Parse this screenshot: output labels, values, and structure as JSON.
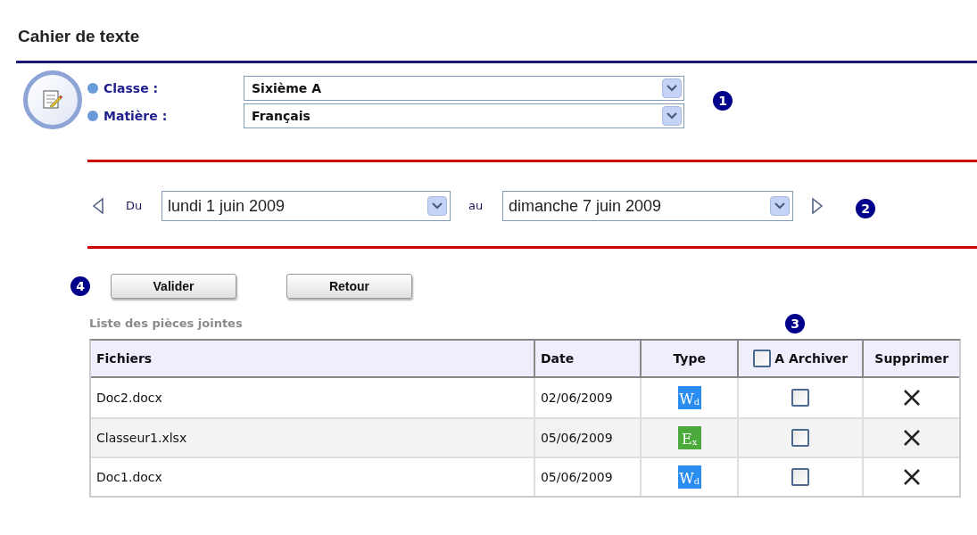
{
  "title": "Cahier de texte",
  "filters": [
    {
      "label": "Classe :",
      "value": "Sixième A"
    },
    {
      "label": "Matière :",
      "value": "Français"
    }
  ],
  "filters_marker": "1",
  "period": {
    "from_label": "Du",
    "from": "lundi 1 juin 2009",
    "to_label": "au",
    "to": "dimanche 7 juin 2009",
    "marker": "2"
  },
  "buttons_marker": "4",
  "buttons": [
    "Valider",
    "Retour"
  ],
  "attachments": {
    "title": "Liste des pièces jointes",
    "marker": "3",
    "columns": [
      "Fichiers",
      "Date",
      "Type",
      "A Archiver",
      "Supprimer"
    ],
    "archive_all_checked": false,
    "rows": [
      {
        "file": "Doc2.docx",
        "date": "02/06/2009",
        "type": {
          "kind": "word",
          "letter": "W",
          "sub": "d"
        },
        "checked": false
      },
      {
        "file": "Classeur1.xlsx",
        "date": "05/06/2009",
        "type": {
          "kind": "excel",
          "letter": "E",
          "sub": "x"
        },
        "checked": false
      },
      {
        "file": "Doc1.docx",
        "date": "05/06/2009",
        "type": {
          "kind": "word",
          "letter": "W",
          "sub": "d"
        },
        "checked": false
      }
    ]
  }
}
